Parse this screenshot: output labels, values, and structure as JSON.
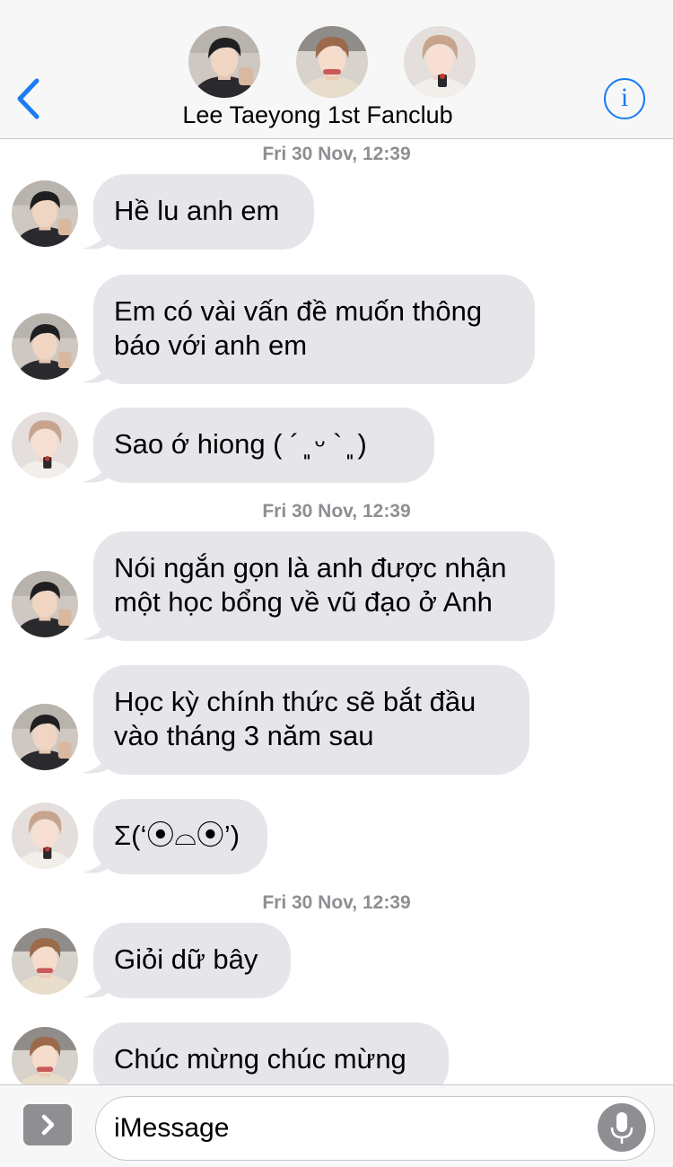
{
  "header": {
    "title": "Lee Taeyong 1st Fanclub",
    "avatars": [
      "member-1-avatar",
      "member-2-avatar",
      "member-3-avatar"
    ]
  },
  "timestamps": [
    "Fri 30 Nov, 12:39",
    "Fri 30 Nov, 12:39",
    "Fri 30 Nov, 12:39"
  ],
  "messages": [
    {
      "sender": "member-1",
      "lines": [
        "Hề lu anh em"
      ]
    },
    {
      "sender": "member-1",
      "lines": [
        "Em có vài vấn đề muốn thông",
        "báo với anh em"
      ]
    },
    {
      "sender": "member-3",
      "lines": [
        "Sao ớ hiong ( ´ ͈ ᵕ ` ͈ )"
      ]
    },
    {
      "sender": "member-1",
      "lines": [
        "Nói ngắn gọn là anh được nhận",
        "một học bổng về vũ đạo ở Anh"
      ]
    },
    {
      "sender": "member-1",
      "lines": [
        "Học kỳ chính thức sẽ bắt đầu",
        "vào tháng 3 năm sau"
      ]
    },
    {
      "sender": "member-3",
      "lines": [
        "Σ(‘⦿⌓⦿’)"
      ]
    },
    {
      "sender": "member-2",
      "lines": [
        "Giỏi dữ bây"
      ]
    },
    {
      "sender": "member-2",
      "lines": [
        "Chúc mừng chúc mừng"
      ]
    }
  ],
  "input": {
    "placeholder": "iMessage"
  },
  "colors": {
    "accent": "#1b7cf2",
    "bubble": "#e5e5ea",
    "timestamp": "#8e8e93"
  },
  "icons": {
    "back": "chevron-left-icon",
    "info": "info-icon",
    "apps": "chevron-right-icon",
    "mic": "microphone-icon"
  }
}
